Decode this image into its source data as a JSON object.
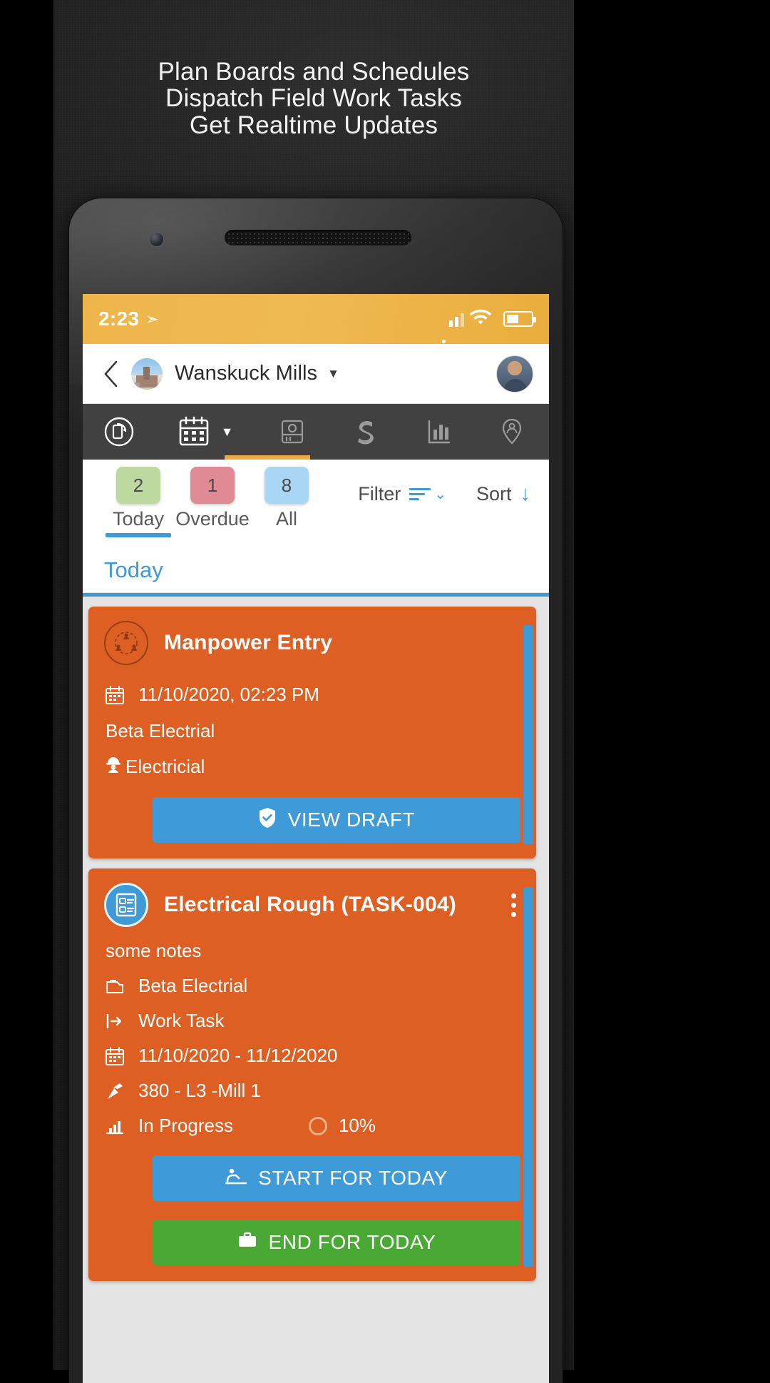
{
  "promo": {
    "headline_lines": [
      "Plan Boards and Schedules",
      "Dispatch Field Work Tasks",
      "Get Realtime Updates"
    ]
  },
  "status_bar": {
    "time": "2:23",
    "location_icon": "navigation-arrow-icon",
    "signal_icon": "signal-bars-icon",
    "wifi_icon": "wifi-icon",
    "battery_icon": "battery-icon",
    "background_color": "#eeb54a"
  },
  "app_bar": {
    "back_icon": "back-chevron-icon",
    "project_thumb_icon": "project-photo-thumbnail",
    "project_title": "Wanskuck Mills",
    "dropdown_icon": "chevron-down-icon",
    "avatar_icon": "user-avatar"
  },
  "tab_strip": {
    "background_color": "#414141",
    "active_indicator_color": "#eeab44",
    "tabs": [
      {
        "name": "rotate-device-icon",
        "active": false
      },
      {
        "name": "calendar-icon",
        "active": true
      },
      {
        "name": "box-icon",
        "active": false
      },
      {
        "name": "s-logo-icon",
        "active": false
      },
      {
        "name": "bar-chart-icon",
        "active": false
      },
      {
        "name": "map-pin-person-icon",
        "active": false
      }
    ],
    "calendar_dropdown_icon": "caret-down-icon"
  },
  "filter_row": {
    "chips": [
      {
        "count": "2",
        "label": "Today",
        "color": "#bdd9a0",
        "selected": true
      },
      {
        "count": "1",
        "label": "Overdue",
        "color": "#e08a96",
        "selected": false
      },
      {
        "count": "8",
        "label": "All",
        "color": "#a8d6f4",
        "selected": false
      }
    ],
    "filter_label": "Filter",
    "filter_icon": "filter-lines-icon",
    "sort_label": "Sort",
    "sort_icon": "sort-down-arrow-icon",
    "selected_underline_color": "#3e9ad6"
  },
  "section_header": {
    "title": "Today",
    "color": "#3e9ad6"
  },
  "cards": [
    {
      "icon": "manpower-network-icon",
      "title": "Manpower Entry",
      "datetime_icon": "calendar-icon",
      "datetime": "11/10/2020, 02:23 PM",
      "company": "Beta Electrial",
      "trade_icon": "hard-hat-worker-icon",
      "trade": "Electricial",
      "actions": [
        {
          "label": "VIEW DRAFT",
          "icon": "shield-check-icon",
          "color": "#3f9ad8"
        }
      ],
      "background_color": "#dd5f23"
    },
    {
      "icon": "checklist-icon",
      "title": "Electrical Rough (TASK-004)",
      "menu_icon": "kebab-menu-icon",
      "notes": "some notes",
      "meta": [
        {
          "icon": "company-icon",
          "text": "Beta Electrial"
        },
        {
          "icon": "task-type-icon",
          "text": "Work Task"
        },
        {
          "icon": "calendar-icon",
          "text": "11/10/2020 - 11/12/2020"
        },
        {
          "icon": "location-pin-icon",
          "text": "380 - L3 -Mill 1"
        }
      ],
      "status_icon": "progress-chart-icon",
      "status": "In Progress",
      "progress_icon": "progress-ring-icon",
      "progress": "10%",
      "actions": [
        {
          "label": "START FOR TODAY",
          "icon": "start-work-icon",
          "color": "#3f9ad8"
        },
        {
          "label": "END FOR TODAY",
          "icon": "briefcase-icon",
          "color": "#4aa834"
        }
      ],
      "background_color": "#dd5f23"
    }
  ]
}
